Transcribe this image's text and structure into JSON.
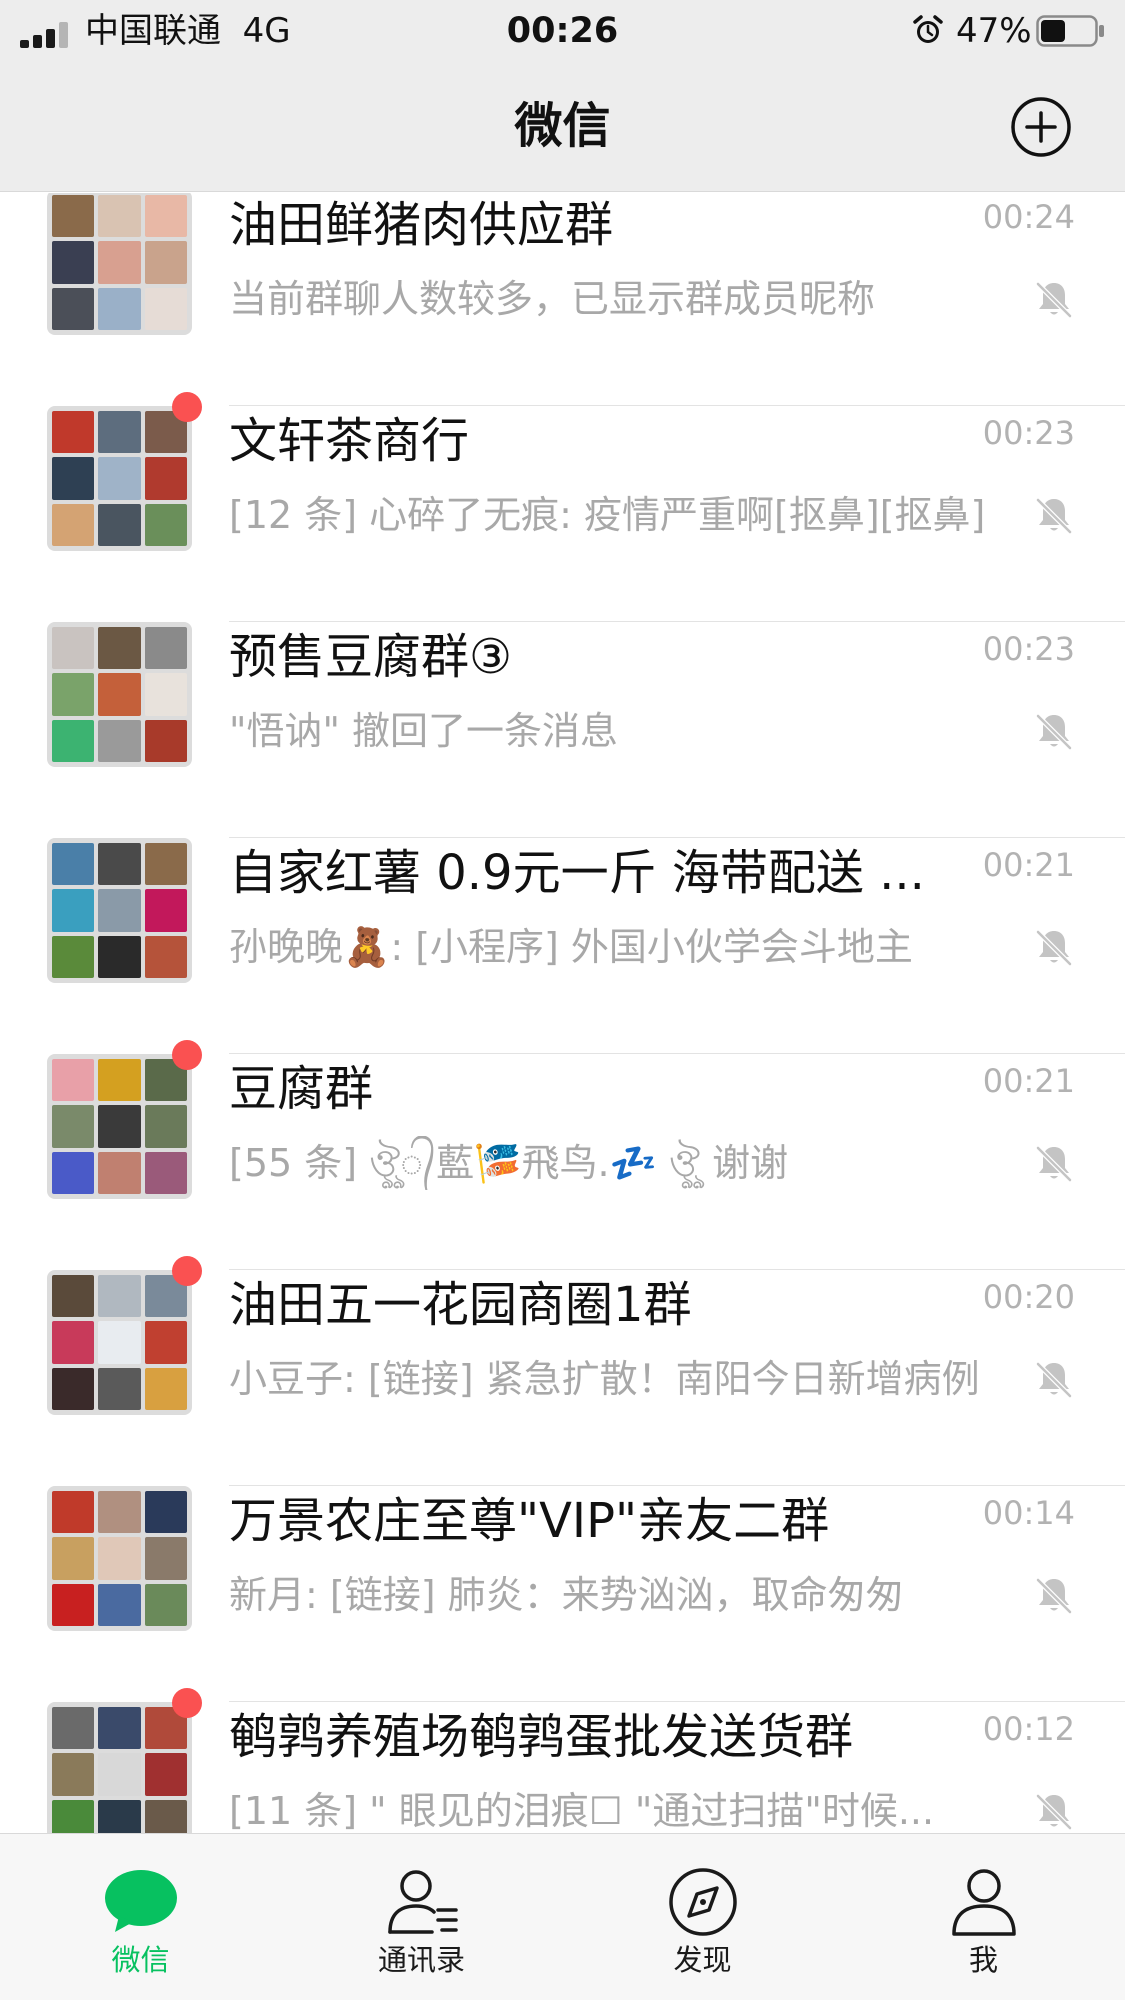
{
  "status_bar": {
    "carrier": "中国联通",
    "network": "4G",
    "time": "00:26",
    "battery_percent": "47%",
    "battery_level": 0.47,
    "signal_bars_filled": 3,
    "signal_bars_total": 4
  },
  "nav": {
    "title": "微信",
    "add_icon": "plus-circle-icon"
  },
  "colors": {
    "wechat_green": "#07c160",
    "unread_red": "#fa5151",
    "muted_gray": "#b2b2b2"
  },
  "chats": [
    {
      "name": "油田鲜猪肉供应群",
      "time": "00:24",
      "preview": "当前群聊人数较多，已显示群成员昵称",
      "unread": false,
      "muted": true,
      "avatar_tiles": [
        "#8a6a4a",
        "#d9c3b2",
        "#e8b8a6",
        "#3a3f52",
        "#d8a090",
        "#c9a38c",
        "#4b4f58",
        "#9ab0c8",
        "#e6dcd6"
      ]
    },
    {
      "name": "文轩茶商行",
      "time": "00:23",
      "preview": "[12 条] 心碎了无痕: 疫情严重啊[抠鼻][抠鼻]",
      "unread": true,
      "muted": true,
      "avatar_tiles": [
        "#c0392b",
        "#5d6d7e",
        "#7b5b4b",
        "#2e4053",
        "#9fb3c8",
        "#b03a2e",
        "#d4a373",
        "#4a5560",
        "#6a8f5a"
      ]
    },
    {
      "name": "预售豆腐群③",
      "time": "00:23",
      "preview": "\"悟讷\" 撤回了一条消息",
      "unread": false,
      "muted": true,
      "avatar_tiles": [
        "#c9c3c0",
        "#6b5844",
        "#8a8a8a",
        "#7aa36a",
        "#c4603a",
        "#e8e2dc",
        "#3cb371",
        "#9a9a9a",
        "#a83a2a"
      ]
    },
    {
      "name": "自家红薯 0.9元一斤 海带配送 ...",
      "time": "00:21",
      "preview": "孙晚晚🧸: [小程序] 外国小伙学会斗地主",
      "unread": false,
      "muted": true,
      "avatar_tiles": [
        "#4a7fa8",
        "#4a4a4a",
        "#8a6a4a",
        "#3a9fbf",
        "#8a9aa8",
        "#c2185b",
        "#5a8a3a",
        "#2a2a2a",
        "#b5533a"
      ]
    },
    {
      "name": "豆腐群",
      "time": "00:21",
      "preview": "[55 条] ঔৣ᭄藍🎏飛鸟.💤 ঔৣ 谢谢",
      "unread": true,
      "muted": true,
      "avatar_tiles": [
        "#e8a0a8",
        "#d4a020",
        "#5a6a4a",
        "#7a8a6a",
        "#3a3a3a",
        "#6a7a5a",
        "#4a5ac8",
        "#c08070",
        "#9a5a7a"
      ]
    },
    {
      "name": "油田五一花园商圈1群",
      "time": "00:20",
      "preview": "小豆子: [链接] 紧急扩散！南阳今日新增病例",
      "unread": true,
      "muted": true,
      "avatar_tiles": [
        "#5a4a3a",
        "#b0b8c0",
        "#7a8a9a",
        "#c83a5a",
        "#e8ecf0",
        "#c04030",
        "#3a2a2a",
        "#5a5a5a",
        "#d8a040"
      ]
    },
    {
      "name": "万景农庄至尊\"VIP\"亲友二群",
      "time": "00:14",
      "preview": "新月: [链接] 肺炎：来势汹汹，取命匆匆",
      "unread": false,
      "muted": true,
      "avatar_tiles": [
        "#c03a2a",
        "#b09080",
        "#2a3a5a",
        "#c8a060",
        "#e0c8b8",
        "#8a7a6a",
        "#c82020",
        "#4a6aa0",
        "#6a8a5a"
      ]
    },
    {
      "name": "鹌鹑养殖场鹌鹑蛋批发送货群",
      "time": "00:12",
      "preview": "[11 条] \" 眼见的泪痕☐ \"通过扫描\"时候...",
      "unread": true,
      "muted": true,
      "avatar_tiles": [
        "#6a6a6a",
        "#3a4a6a",
        "#b04a3a",
        "#8a7a5a",
        "#d8d8d8",
        "#a03030",
        "#4a8a3a",
        "#2a3a4a",
        "#6a5a4a"
      ]
    }
  ],
  "tabs": [
    {
      "label": "微信",
      "icon": "chat-bubble-icon",
      "active": true
    },
    {
      "label": "通讯录",
      "icon": "contacts-icon",
      "active": false
    },
    {
      "label": "发现",
      "icon": "compass-icon",
      "active": false
    },
    {
      "label": "我",
      "icon": "person-icon",
      "active": false
    }
  ]
}
